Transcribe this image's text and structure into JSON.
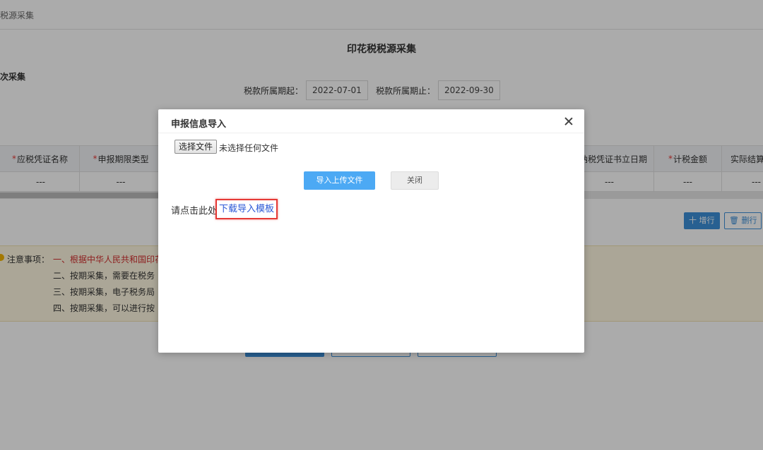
{
  "breadcrumb": "税源采集",
  "page_title": "印花税税源采集",
  "side_label": "次采集",
  "period": {
    "start_label": "税款所属期起：",
    "start_value": "2022-07-01",
    "end_label": "税款所属期止：",
    "end_value": "2022-09-30"
  },
  "table": {
    "headers": [
      {
        "label": "应税凭证名称",
        "required": true
      },
      {
        "label": "申报期限类型",
        "required": true
      },
      {
        "label": "",
        "required": false
      },
      {
        "label": "纳税凭证书立日期",
        "required": false
      },
      {
        "label": "计税金额",
        "required": true
      },
      {
        "label": "实际结算",
        "required": false
      }
    ],
    "row": [
      "---",
      "---",
      "",
      "---",
      "---",
      "---"
    ]
  },
  "actions": {
    "add": "十 增行",
    "delete": "🗑 删行"
  },
  "notice": {
    "label": "注意事项：",
    "lines": [
      "一、根据中华人民共和国印花",
      "二、按期采集，需要在税务",
      "三、按期采集，电子税务局",
      "四、按期采集，可以进行按"
    ]
  },
  "modal": {
    "title": "申报信息导入",
    "choose_file": "选择文件",
    "file_status": "未选择任何文件",
    "upload_button": "导入上传文件",
    "close_button": "关闭",
    "hint_prefix": "请点击此处",
    "template_link": "下载导入模板"
  }
}
